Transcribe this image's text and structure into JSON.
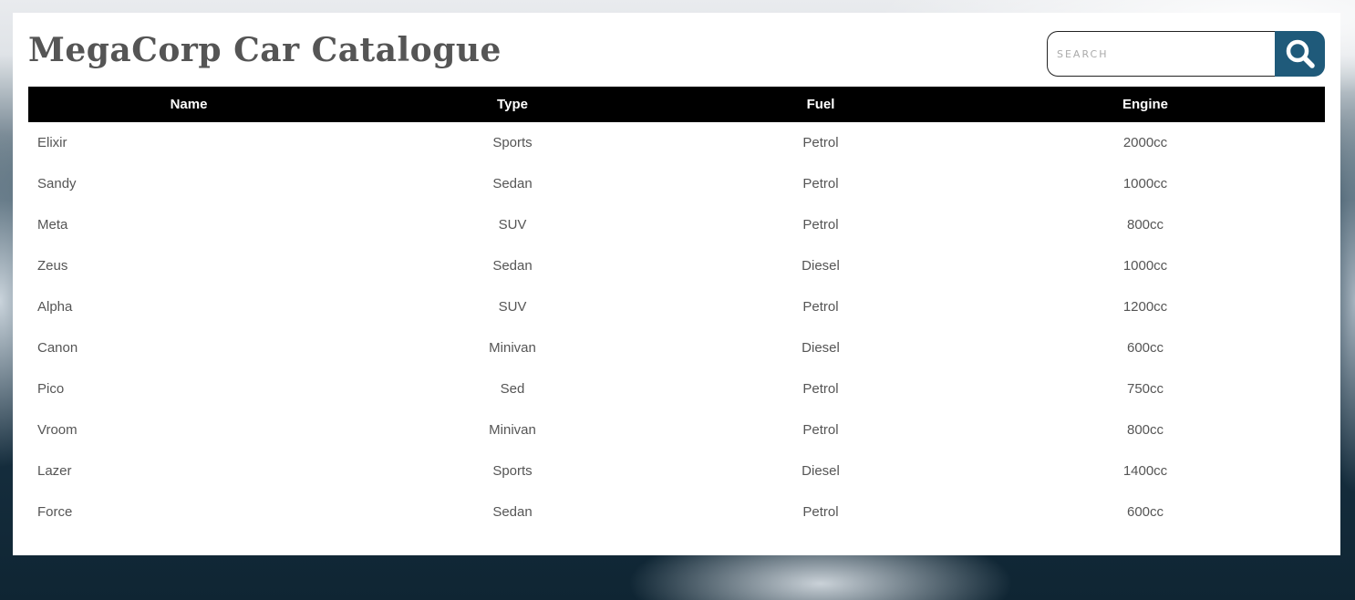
{
  "page": {
    "title": "MegaCorp Car Catalogue"
  },
  "search": {
    "placeholder": "SEARCH",
    "value": "",
    "button_icon": "search-icon"
  },
  "colors": {
    "title": "#555555",
    "header_bg": "#000000",
    "header_text": "#ffffff",
    "search_button": "#1f5a7a",
    "cell_text": "#555555"
  },
  "table": {
    "columns": [
      "Name",
      "Type",
      "Fuel",
      "Engine"
    ],
    "rows": [
      {
        "name": "Elixir",
        "type": "Sports",
        "fuel": "Petrol",
        "engine": "2000cc"
      },
      {
        "name": "Sandy",
        "type": "Sedan",
        "fuel": "Petrol",
        "engine": "1000cc"
      },
      {
        "name": "Meta",
        "type": "SUV",
        "fuel": "Petrol",
        "engine": "800cc"
      },
      {
        "name": "Zeus",
        "type": "Sedan",
        "fuel": "Diesel",
        "engine": "1000cc"
      },
      {
        "name": "Alpha",
        "type": "SUV",
        "fuel": "Petrol",
        "engine": "1200cc"
      },
      {
        "name": "Canon",
        "type": "Minivan",
        "fuel": "Diesel",
        "engine": "600cc"
      },
      {
        "name": "Pico",
        "type": "Sed",
        "fuel": "Petrol",
        "engine": "750cc"
      },
      {
        "name": "Vroom",
        "type": "Minivan",
        "fuel": "Petrol",
        "engine": "800cc"
      },
      {
        "name": "Lazer",
        "type": "Sports",
        "fuel": "Diesel",
        "engine": "1400cc"
      },
      {
        "name": "Force",
        "type": "Sedan",
        "fuel": "Petrol",
        "engine": "600cc"
      }
    ]
  }
}
